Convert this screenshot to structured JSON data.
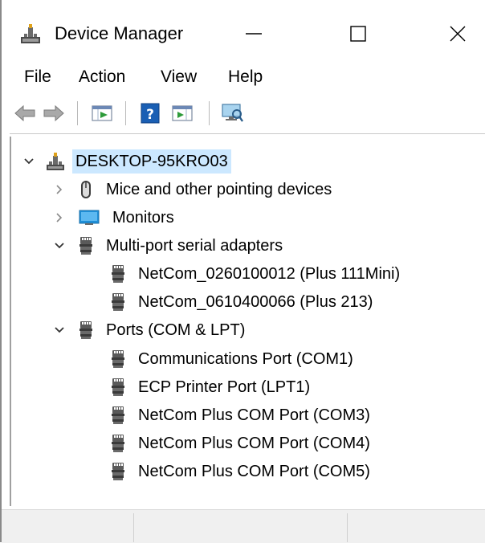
{
  "window": {
    "title": "Device Manager",
    "app_icon": "device-manager-icon",
    "buttons": [
      "minimize-icon",
      "maximize-icon",
      "close-icon"
    ]
  },
  "menu": {
    "items": [
      {
        "label": "File"
      },
      {
        "label": "Action"
      },
      {
        "label": "View"
      },
      {
        "label": "Help"
      }
    ]
  },
  "toolbar": {
    "icons": [
      "back-arrow-icon",
      "forward-arrow-icon",
      "properties-icon",
      "help-icon",
      "action-pane-icon",
      "scan-hardware-icon"
    ]
  },
  "tree": {
    "root": {
      "label": "DESKTOP-95KRO03",
      "expanded": true,
      "icon": "computer-icon"
    },
    "categories": [
      {
        "label": "Mice and other pointing devices",
        "expanded": false,
        "icon": "mouse-icon",
        "children": []
      },
      {
        "label": "Monitors",
        "expanded": false,
        "icon": "monitor-icon",
        "children": []
      },
      {
        "label": "Multi-port serial adapters",
        "expanded": true,
        "icon": "port-icon",
        "children": [
          {
            "label": "NetCom_0260100012 (Plus 111Mini)"
          },
          {
            "label": "NetCom_0610400066 (Plus 213)"
          }
        ]
      },
      {
        "label": "Ports (COM & LPT)",
        "expanded": true,
        "icon": "port-icon",
        "children": [
          {
            "label": "Communications Port (COM1)"
          },
          {
            "label": "ECP Printer Port (LPT1)"
          },
          {
            "label": "NetCom Plus COM Port (COM3)"
          },
          {
            "label": "NetCom Plus COM Port (COM4)"
          },
          {
            "label": "NetCom Plus COM Port (COM5)"
          }
        ]
      }
    ]
  },
  "colors": {
    "selection": "#cce8ff",
    "monitor": "#1e8fd8",
    "help_blue": "#1a5fb4"
  }
}
